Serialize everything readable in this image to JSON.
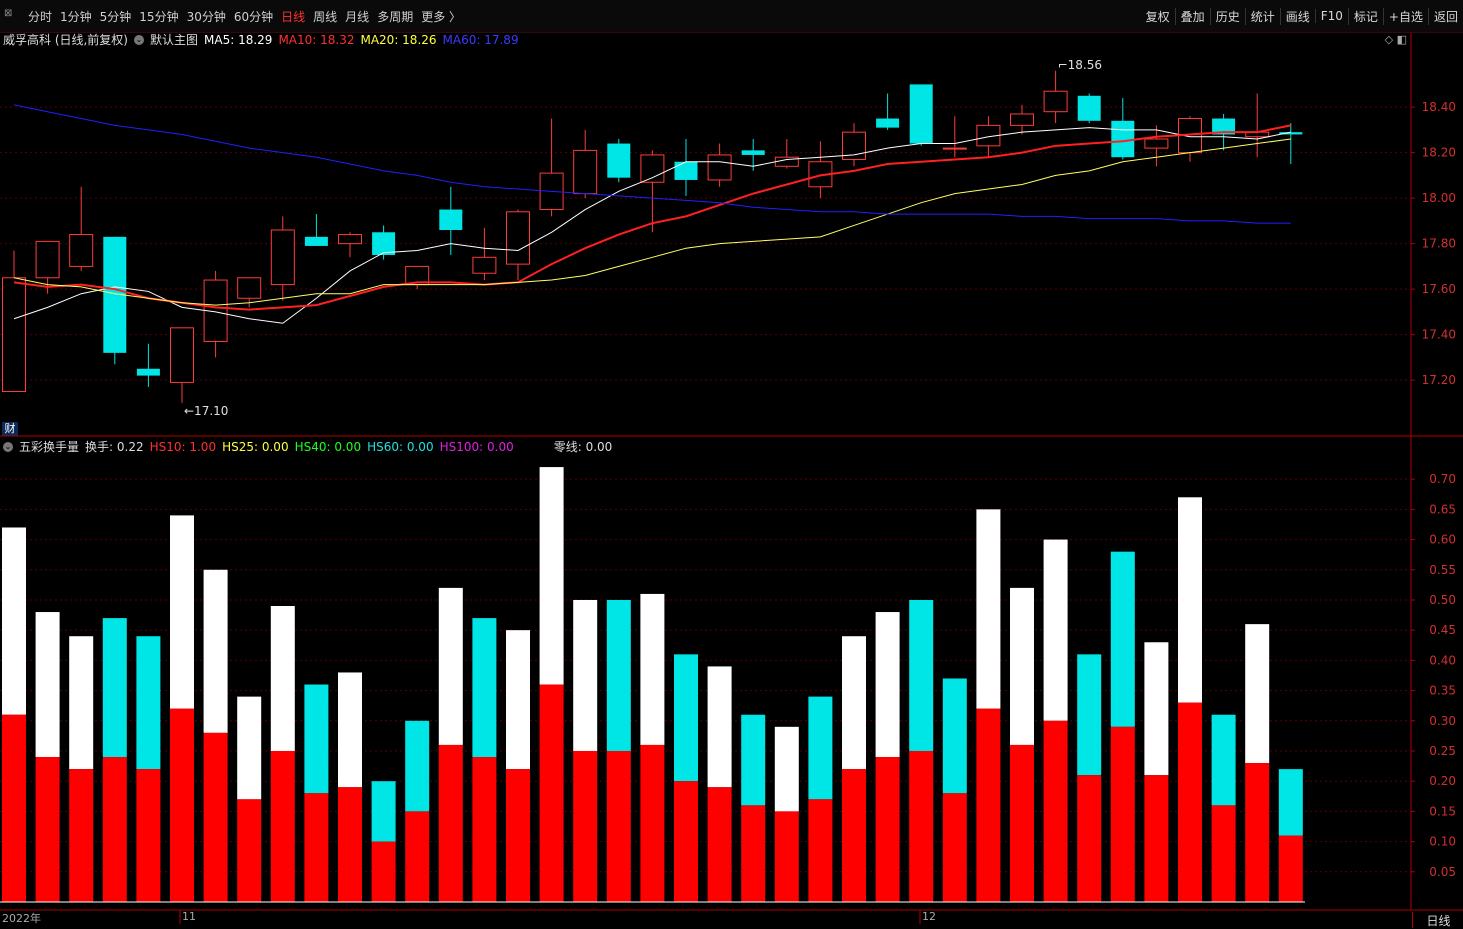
{
  "toolbar": {
    "tabs": [
      {
        "label": "分时",
        "active": false
      },
      {
        "label": "1分钟",
        "active": false
      },
      {
        "label": "5分钟",
        "active": false
      },
      {
        "label": "15分钟",
        "active": false
      },
      {
        "label": "30分钟",
        "active": false
      },
      {
        "label": "60分钟",
        "active": false
      },
      {
        "label": "日线",
        "active": true
      },
      {
        "label": "周线",
        "active": false
      },
      {
        "label": "月线",
        "active": false
      },
      {
        "label": "多周期",
        "active": false
      },
      {
        "label": "更多 〉",
        "active": false
      }
    ],
    "right": [
      "复权",
      "叠加",
      "历史",
      "统计",
      "画线",
      "F10",
      "标记",
      "+自选",
      "返回"
    ]
  },
  "header": {
    "stock": "威孚高科 (日线,前复权)",
    "main_chart": "默认主图",
    "ma5": "MA5: 18.29",
    "ma10": "MA10: 18.32",
    "ma20": "MA20: 18.26",
    "ma60": "MA60: 17.89"
  },
  "sub_header": {
    "name": "五彩换手量",
    "hs": "换手: 0.22",
    "hs10": "HS10: 1.00",
    "hs25": "HS25: 0.00",
    "hs40": "HS40: 0.00",
    "hs60": "HS60: 0.00",
    "hs100": "HS100: 0.00",
    "zero": "零线: 0.00"
  },
  "badge": "财",
  "bottom": {
    "year": "2022年",
    "m11": "11",
    "m12": "12",
    "period": "日线"
  },
  "colors": {
    "up": "#ff3b3b",
    "down": "#00e5e5",
    "ma5": "#ffffff",
    "ma10": "#ff2020",
    "ma20": "#ffff66",
    "ma60": "#2020ff",
    "axis": "#b00000"
  },
  "chart_data": [
    {
      "type": "candlestick",
      "title": "威孚高科 (日线,前复权)",
      "y_ticks": [
        17.2,
        17.4,
        17.6,
        17.8,
        18.0,
        18.2,
        18.4
      ],
      "ylim": [
        17.06,
        18.66
      ],
      "annotations": [
        {
          "text": "17.10",
          "index": 5
        },
        {
          "text": "18.56",
          "index": 31
        }
      ],
      "candles": [
        {
          "o": 17.15,
          "h": 17.77,
          "l": 17.15,
          "c": 17.65
        },
        {
          "o": 17.65,
          "h": 17.8,
          "l": 17.58,
          "c": 17.81
        },
        {
          "o": 17.7,
          "h": 18.05,
          "l": 17.68,
          "c": 17.84
        },
        {
          "o": 17.83,
          "h": 17.83,
          "l": 17.27,
          "c": 17.32
        },
        {
          "o": 17.25,
          "h": 17.36,
          "l": 17.17,
          "c": 17.22
        },
        {
          "o": 17.19,
          "h": 17.43,
          "l": 17.1,
          "c": 17.43
        },
        {
          "o": 17.37,
          "h": 17.68,
          "l": 17.3,
          "c": 17.64
        },
        {
          "o": 17.56,
          "h": 17.65,
          "l": 17.52,
          "c": 17.65
        },
        {
          "o": 17.62,
          "h": 17.92,
          "l": 17.55,
          "c": 17.86
        },
        {
          "o": 17.83,
          "h": 17.93,
          "l": 17.79,
          "c": 17.79
        },
        {
          "o": 17.8,
          "h": 17.85,
          "l": 17.74,
          "c": 17.84
        },
        {
          "o": 17.85,
          "h": 17.88,
          "l": 17.73,
          "c": 17.75
        },
        {
          "o": 17.62,
          "h": 17.7,
          "l": 17.6,
          "c": 17.7
        },
        {
          "o": 17.95,
          "h": 18.05,
          "l": 17.75,
          "c": 17.86
        },
        {
          "o": 17.67,
          "h": 17.87,
          "l": 17.64,
          "c": 17.74
        },
        {
          "o": 17.71,
          "h": 17.95,
          "l": 17.64,
          "c": 17.94
        },
        {
          "o": 17.95,
          "h": 18.35,
          "l": 17.92,
          "c": 18.11
        },
        {
          "o": 18.02,
          "h": 18.3,
          "l": 18.0,
          "c": 18.21
        },
        {
          "o": 18.24,
          "h": 18.26,
          "l": 18.07,
          "c": 18.09
        },
        {
          "o": 18.07,
          "h": 18.21,
          "l": 17.85,
          "c": 18.19
        },
        {
          "o": 18.16,
          "h": 18.26,
          "l": 18.01,
          "c": 18.08
        },
        {
          "o": 18.08,
          "h": 18.24,
          "l": 18.05,
          "c": 18.19
        },
        {
          "o": 18.21,
          "h": 18.26,
          "l": 18.12,
          "c": 18.19
        },
        {
          "o": 18.14,
          "h": 18.26,
          "l": 18.13,
          "c": 18.18
        },
        {
          "o": 18.05,
          "h": 18.25,
          "l": 18.0,
          "c": 18.16
        },
        {
          "o": 18.17,
          "h": 18.33,
          "l": 18.14,
          "c": 18.29
        },
        {
          "o": 18.35,
          "h": 18.46,
          "l": 18.3,
          "c": 18.31
        },
        {
          "o": 18.5,
          "h": 18.48,
          "l": 18.23,
          "c": 18.24
        },
        {
          "o": 18.22,
          "h": 18.36,
          "l": 18.18,
          "c": 18.22
        },
        {
          "o": 18.23,
          "h": 18.36,
          "l": 18.18,
          "c": 18.32
        },
        {
          "o": 18.32,
          "h": 18.41,
          "l": 18.28,
          "c": 18.37
        },
        {
          "o": 18.38,
          "h": 18.56,
          "l": 18.33,
          "c": 18.47
        },
        {
          "o": 18.45,
          "h": 18.46,
          "l": 18.33,
          "c": 18.34
        },
        {
          "o": 18.34,
          "h": 18.44,
          "l": 18.17,
          "c": 18.18
        },
        {
          "o": 18.22,
          "h": 18.32,
          "l": 18.14,
          "c": 18.26
        },
        {
          "o": 18.2,
          "h": 18.36,
          "l": 18.16,
          "c": 18.35
        },
        {
          "o": 18.35,
          "h": 18.37,
          "l": 18.21,
          "c": 18.28
        },
        {
          "o": 18.27,
          "h": 18.46,
          "l": 18.18,
          "c": 18.29
        },
        {
          "o": 18.29,
          "h": 18.33,
          "l": 18.15,
          "c": 18.28
        }
      ],
      "series": [
        {
          "name": "MA5",
          "values": [
            17.47,
            17.52,
            17.58,
            17.61,
            17.59,
            17.52,
            17.5,
            17.47,
            17.45,
            17.56,
            17.68,
            17.76,
            17.77,
            17.8,
            17.78,
            17.77,
            17.85,
            17.95,
            18.03,
            18.09,
            18.16,
            18.16,
            18.14,
            18.17,
            18.18,
            18.19,
            18.22,
            18.24,
            18.24,
            18.27,
            18.29,
            18.3,
            18.31,
            18.3,
            18.3,
            18.27,
            18.27,
            18.26,
            18.29
          ]
        },
        {
          "name": "MA10",
          "values": [
            17.63,
            17.61,
            17.62,
            17.6,
            17.56,
            17.54,
            17.52,
            17.51,
            17.52,
            17.53,
            17.57,
            17.61,
            17.63,
            17.63,
            17.62,
            17.63,
            17.71,
            17.78,
            17.84,
            17.89,
            17.92,
            17.97,
            18.02,
            18.06,
            18.1,
            18.12,
            18.15,
            18.16,
            18.17,
            18.18,
            18.2,
            18.23,
            18.24,
            18.25,
            18.27,
            18.28,
            18.29,
            18.29,
            18.32
          ]
        },
        {
          "name": "MA20",
          "values": [
            17.65,
            17.62,
            17.61,
            17.58,
            17.56,
            17.54,
            17.53,
            17.54,
            17.56,
            17.58,
            17.58,
            17.62,
            17.62,
            17.62,
            17.62,
            17.63,
            17.64,
            17.66,
            17.7,
            17.74,
            17.78,
            17.8,
            17.81,
            17.82,
            17.83,
            17.88,
            17.93,
            17.98,
            18.02,
            18.04,
            18.06,
            18.1,
            18.12,
            18.16,
            18.18,
            18.2,
            18.22,
            18.24,
            18.26
          ]
        },
        {
          "name": "MA60",
          "values": [
            18.41,
            18.38,
            18.35,
            18.32,
            18.3,
            18.28,
            18.25,
            18.22,
            18.2,
            18.18,
            18.15,
            18.12,
            18.1,
            18.07,
            18.05,
            18.04,
            18.03,
            18.02,
            18.01,
            18.0,
            17.99,
            17.98,
            17.96,
            17.95,
            17.94,
            17.94,
            17.93,
            17.93,
            17.93,
            17.93,
            17.92,
            17.92,
            17.91,
            17.91,
            17.91,
            17.9,
            17.9,
            17.89,
            17.89
          ]
        }
      ]
    },
    {
      "type": "bar",
      "title": "五彩换手量",
      "y_ticks": [
        0.05,
        0.1,
        0.15,
        0.2,
        0.25,
        0.3,
        0.35,
        0.4,
        0.45,
        0.5,
        0.55,
        0.6,
        0.65,
        0.7
      ],
      "ylim": [
        0,
        0.74
      ],
      "bars": [
        {
          "red": 0.31,
          "top": 0.62,
          "top_color": "white"
        },
        {
          "red": 0.24,
          "top": 0.48,
          "top_color": "white"
        },
        {
          "red": 0.22,
          "top": 0.44,
          "top_color": "white"
        },
        {
          "red": 0.24,
          "top": 0.47,
          "top_color": "cyan"
        },
        {
          "red": 0.22,
          "top": 0.44,
          "top_color": "cyan"
        },
        {
          "red": 0.32,
          "top": 0.64,
          "top_color": "white"
        },
        {
          "red": 0.28,
          "top": 0.55,
          "top_color": "white"
        },
        {
          "red": 0.17,
          "top": 0.34,
          "top_color": "white"
        },
        {
          "red": 0.25,
          "top": 0.49,
          "top_color": "white"
        },
        {
          "red": 0.18,
          "top": 0.36,
          "top_color": "cyan"
        },
        {
          "red": 0.19,
          "top": 0.38,
          "top_color": "white"
        },
        {
          "red": 0.1,
          "top": 0.2,
          "top_color": "cyan"
        },
        {
          "red": 0.15,
          "top": 0.3,
          "top_color": "cyan"
        },
        {
          "red": 0.26,
          "top": 0.52,
          "top_color": "white"
        },
        {
          "red": 0.24,
          "top": 0.47,
          "top_color": "cyan"
        },
        {
          "red": 0.22,
          "top": 0.45,
          "top_color": "white"
        },
        {
          "red": 0.36,
          "top": 0.72,
          "top_color": "white"
        },
        {
          "red": 0.25,
          "top": 0.5,
          "top_color": "white"
        },
        {
          "red": 0.25,
          "top": 0.5,
          "top_color": "cyan"
        },
        {
          "red": 0.26,
          "top": 0.51,
          "top_color": "white"
        },
        {
          "red": 0.2,
          "top": 0.41,
          "top_color": "cyan"
        },
        {
          "red": 0.19,
          "top": 0.39,
          "top_color": "white"
        },
        {
          "red": 0.16,
          "top": 0.31,
          "top_color": "cyan"
        },
        {
          "red": 0.15,
          "top": 0.29,
          "top_color": "white"
        },
        {
          "red": 0.17,
          "top": 0.34,
          "top_color": "cyan"
        },
        {
          "red": 0.22,
          "top": 0.44,
          "top_color": "white"
        },
        {
          "red": 0.24,
          "top": 0.48,
          "top_color": "white"
        },
        {
          "red": 0.25,
          "top": 0.5,
          "top_color": "cyan"
        },
        {
          "red": 0.18,
          "top": 0.37,
          "top_color": "cyan"
        },
        {
          "red": 0.32,
          "top": 0.65,
          "top_color": "white"
        },
        {
          "red": 0.26,
          "top": 0.52,
          "top_color": "white"
        },
        {
          "red": 0.3,
          "top": 0.6,
          "top_color": "white"
        },
        {
          "red": 0.21,
          "top": 0.41,
          "top_color": "cyan"
        },
        {
          "red": 0.29,
          "top": 0.58,
          "top_color": "cyan"
        },
        {
          "red": 0.21,
          "top": 0.43,
          "top_color": "white"
        },
        {
          "red": 0.33,
          "top": 0.67,
          "top_color": "white"
        },
        {
          "red": 0.16,
          "top": 0.31,
          "top_color": "cyan"
        },
        {
          "red": 0.23,
          "top": 0.46,
          "top_color": "white"
        },
        {
          "red": 0.11,
          "top": 0.22,
          "top_color": "cyan"
        }
      ]
    }
  ]
}
